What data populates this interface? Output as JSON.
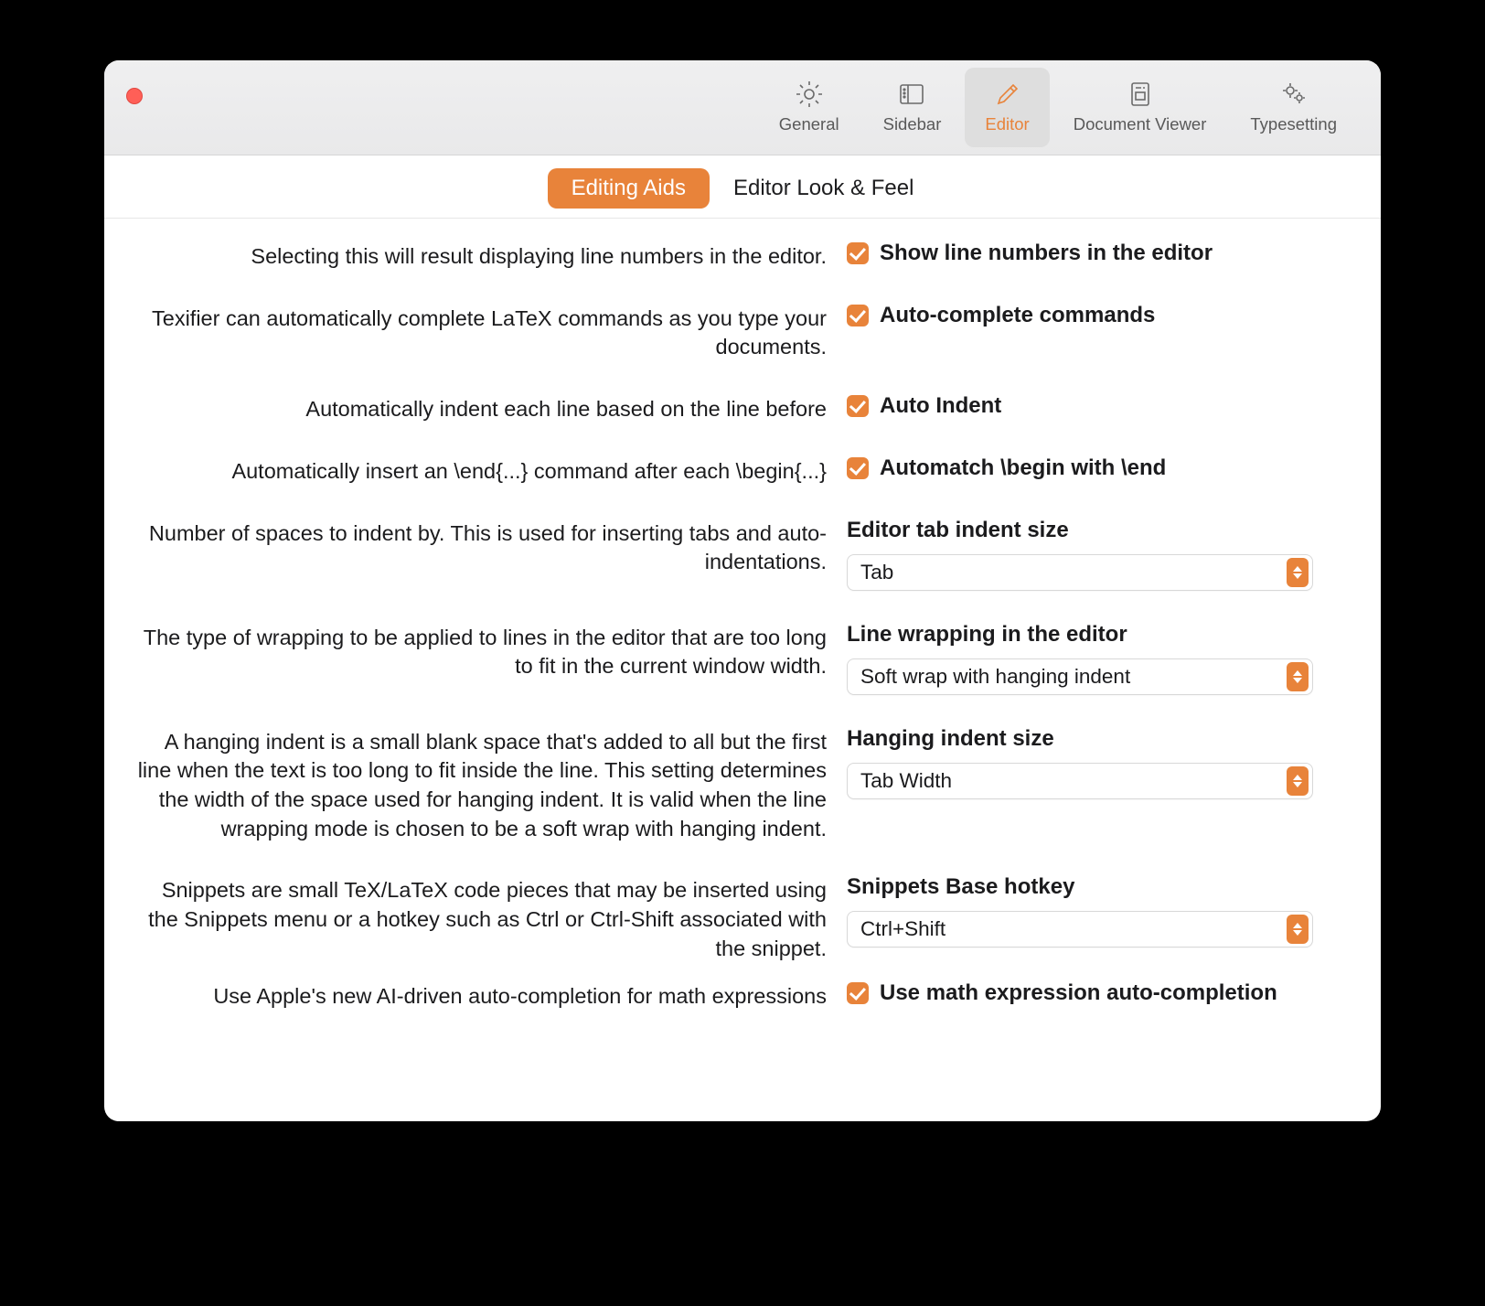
{
  "toolbar": {
    "tabs": [
      {
        "id": "general",
        "label": "General"
      },
      {
        "id": "sidebar",
        "label": "Sidebar"
      },
      {
        "id": "editor",
        "label": "Editor"
      },
      {
        "id": "docviewer",
        "label": "Document Viewer"
      },
      {
        "id": "typesetting",
        "label": "Typesetting"
      }
    ],
    "active": "editor"
  },
  "subtabs": {
    "editing_aids": "Editing Aids",
    "look_feel": "Editor Look & Feel",
    "active": "editing_aids"
  },
  "settings": {
    "line_numbers": {
      "desc": "Selecting this will result displaying line numbers in the editor.",
      "label": "Show line numbers in the editor",
      "checked": true
    },
    "autocomplete": {
      "desc": "Texifier can automatically complete LaTeX commands as you type your documents.",
      "label": "Auto-complete commands",
      "checked": true
    },
    "auto_indent": {
      "desc": "Automatically indent each line based on the line before",
      "label": "Auto Indent",
      "checked": true
    },
    "automatch": {
      "desc": "Automatically insert an \\end{...} command after each \\begin{...}",
      "label": "Automatch \\begin with \\end",
      "checked": true
    },
    "tab_indent": {
      "desc": "Number of spaces to indent by. This is used for inserting tabs and auto-indentations.",
      "label": "Editor tab indent size",
      "value": "Tab"
    },
    "wrapping": {
      "desc": "The type of wrapping to be applied to lines in the editor that are too long to fit in the current window width.",
      "label": "Line wrapping in the editor",
      "value": "Soft wrap with hanging indent"
    },
    "hanging": {
      "desc": "A hanging indent is a small blank space that's added to all but the first line when the text is too long to fit inside the line. This setting determines the width of the space used for hanging indent. It is valid when the line wrapping mode is chosen to be a soft wrap with hanging indent.",
      "label": "Hanging indent size",
      "value": "Tab Width"
    },
    "snippets": {
      "desc": "Snippets are small TeX/LaTeX code pieces that may be inserted using the Snippets menu or a hotkey such as Ctrl or Ctrl-Shift associated with the snippet.",
      "label": "Snippets Base hotkey",
      "value": "Ctrl+Shift"
    },
    "math_ac": {
      "desc": "Use Apple's new AI-driven auto-completion for math expressions",
      "label": "Use math expression auto-completion",
      "checked": true
    }
  }
}
